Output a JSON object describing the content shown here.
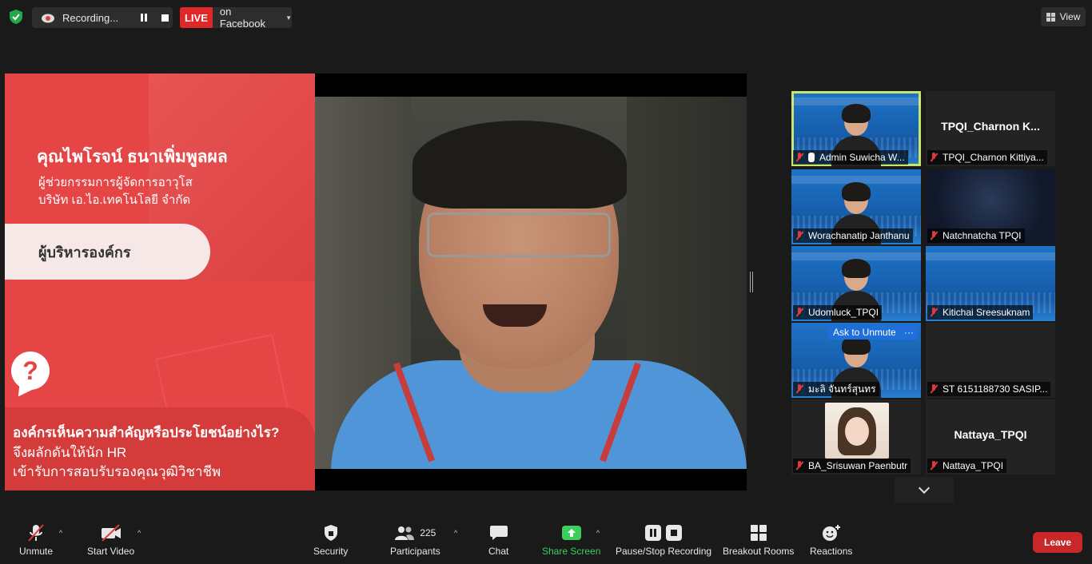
{
  "topbar": {
    "recording_text": "Recording...",
    "live_badge": "LIVE",
    "live_destination": "on Facebook",
    "view_label": "View"
  },
  "slide": {
    "speaker_name": "คุณไพโรจน์ ธนาเพิ่มพูลผล",
    "position_line1": "ผู้ช่วยกรรมการผู้จัดการอาวุโส",
    "position_line2": "บริษัท เอ.ไอ.เทคโนโลยี จำกัด",
    "category": "ผู้บริหารองค์กร",
    "question_mark": "?",
    "question_line1": "องค์กรเห็นความสำคัญหรือประโยชน์อย่างไร?",
    "question_line2": "จึงผลักดันให้นัก HR",
    "question_line3": "เข้ารับการสอบรับรองคุณวุฒิวิชาชีพ"
  },
  "gallery": {
    "tiles": [
      {
        "label": "Admin Suwicha W..."
      },
      {
        "label": "TPQI_Charnon Kittiya...",
        "center_name": "TPQI_Charnon  K..."
      },
      {
        "label": "Worachanatip Janthanu"
      },
      {
        "label": "Natchnatcha TPQI"
      },
      {
        "label": "Udomluck_TPQI"
      },
      {
        "label": "Kitichai Sreesuknam"
      },
      {
        "label": "มะลิ จันทร์สุนทร",
        "ask_to_unmute": "Ask to Unmute",
        "more": "···"
      },
      {
        "label": "ST 6151188730 SASIP..."
      },
      {
        "label": "BA_Srisuwan Paenbutr"
      },
      {
        "label": "Nattaya_TPQI",
        "center_name": "Nattaya_TPQI"
      }
    ]
  },
  "toolbar": {
    "unmute": "Unmute",
    "start_video": "Start Video",
    "security": "Security",
    "participants": "Participants",
    "participants_count": "225",
    "chat": "Chat",
    "share_screen": "Share Screen",
    "pause_stop_recording": "Pause/Stop Recording",
    "breakout_rooms": "Breakout Rooms",
    "reactions": "Reactions",
    "leave": "Leave"
  },
  "colors": {
    "live_red": "#e02828",
    "leave_red": "#c82828",
    "share_green": "#3ccf5b",
    "active_speaker_border": "#c6e66a",
    "ask_unmute_blue": "#1e6fd9"
  }
}
